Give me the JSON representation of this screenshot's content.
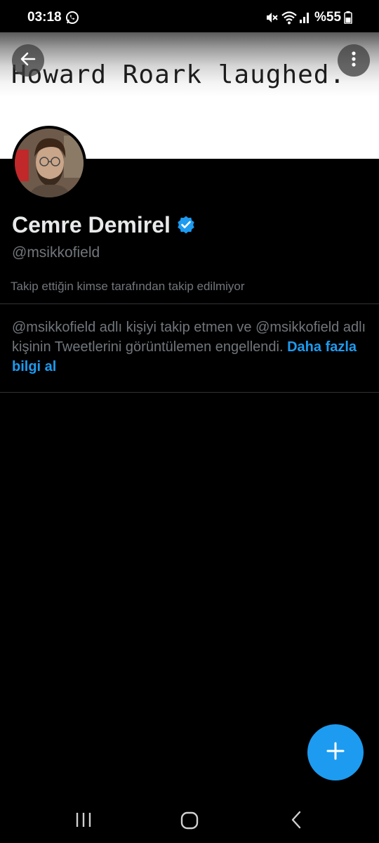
{
  "status_bar": {
    "time": "03:18",
    "battery_text": "%55",
    "icons": [
      "whatsapp-icon",
      "mute-icon",
      "wifi-icon",
      "signal-icon",
      "battery-icon"
    ]
  },
  "banner": {
    "quote": "Howard Roark laughed."
  },
  "profile": {
    "name": "Cemre Demirel",
    "handle": "@msikkofield",
    "follow_context": "Takip ettiğin kimse tarafından takip edilmiyor",
    "verified": true
  },
  "blocked_notice": {
    "message": "@msikkofield adlı kişiyi takip etmen ve @msikkofield adlı kişinin Tweetlerini görüntülemen engellendi.",
    "link_label": "Daha fazla bilgi al"
  },
  "colors": {
    "accent": "#1d9bf0",
    "background": "#000000",
    "secondary_text": "#71767b",
    "primary_text": "#e7e9ea"
  },
  "icons": {
    "back": "arrow-left-icon",
    "more": "more-vertical-icon",
    "verified": "verified-badge-icon",
    "compose": "plus-icon",
    "nav": [
      "recents-icon",
      "home-icon",
      "back-chevron-icon"
    ]
  }
}
